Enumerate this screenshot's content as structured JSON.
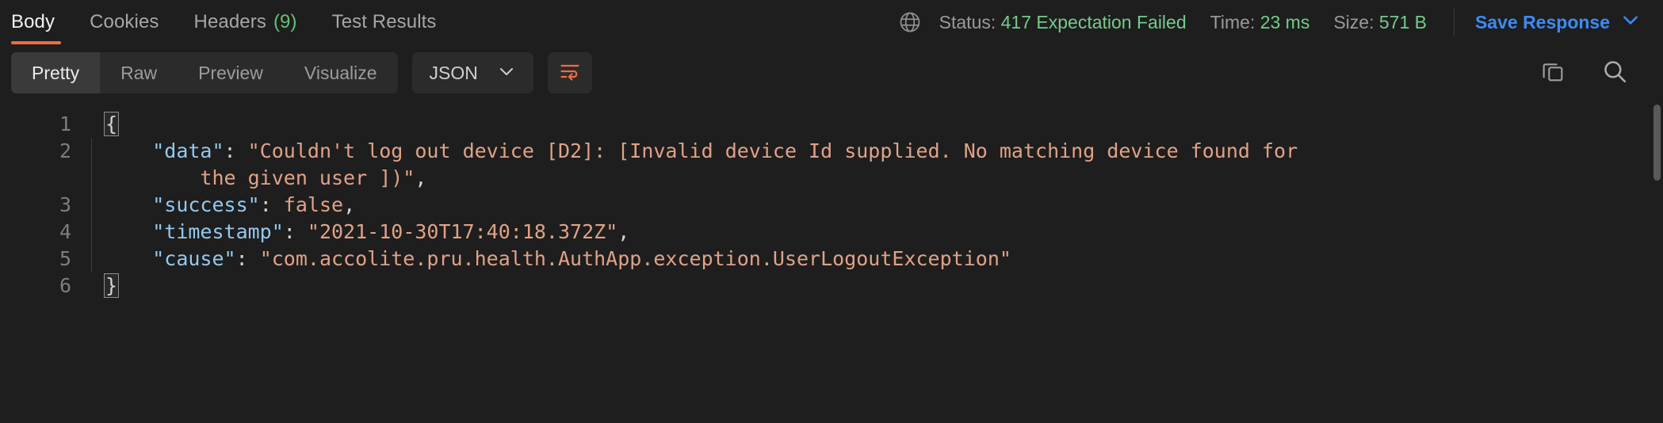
{
  "response_tabs": [
    {
      "label": "Body",
      "active": true,
      "count": null
    },
    {
      "label": "Cookies",
      "active": false,
      "count": null
    },
    {
      "label": "Headers",
      "active": false,
      "count": "(9)"
    },
    {
      "label": "Test Results",
      "active": false,
      "count": null
    }
  ],
  "status": {
    "globe_icon": "globe-icon",
    "status_label": "Status: ",
    "status_value": "417 Expectation Failed",
    "time_label": "Time: ",
    "time_value": "23 ms",
    "size_label": "Size: ",
    "size_value": "571 B",
    "save_response_label": "Save Response",
    "save_chevron_icon": "chevron-down-icon"
  },
  "toolbar": {
    "view_tabs": [
      {
        "label": "Pretty",
        "active": true
      },
      {
        "label": "Raw",
        "active": false
      },
      {
        "label": "Preview",
        "active": false
      },
      {
        "label": "Visualize",
        "active": false
      }
    ],
    "language": "JSON",
    "language_chevron_icon": "chevron-down-icon",
    "wrap_icon": "wrap-lines-icon",
    "copy_icon": "copy-icon",
    "search_icon": "search-icon"
  },
  "code": {
    "lines": [
      {
        "number": "1",
        "segments": [
          {
            "t": "{",
            "c": "brace"
          }
        ]
      },
      {
        "number": "2",
        "segments": [
          {
            "t": "    ",
            "c": "p"
          },
          {
            "t": "\"data\"",
            "c": "k"
          },
          {
            "t": ": ",
            "c": "p"
          },
          {
            "t": "\"Couldn't log out device [D2]: [Invalid device Id supplied. No matching device found for",
            "c": "s"
          }
        ]
      },
      {
        "number": "",
        "segments": [
          {
            "t": "        ",
            "c": "p"
          },
          {
            "t": "the given user ])\"",
            "c": "s"
          },
          {
            "t": ",",
            "c": "p"
          }
        ]
      },
      {
        "number": "3",
        "segments": [
          {
            "t": "    ",
            "c": "p"
          },
          {
            "t": "\"success\"",
            "c": "k"
          },
          {
            "t": ": ",
            "c": "p"
          },
          {
            "t": "false",
            "c": "b"
          },
          {
            "t": ",",
            "c": "p"
          }
        ]
      },
      {
        "number": "4",
        "segments": [
          {
            "t": "    ",
            "c": "p"
          },
          {
            "t": "\"timestamp\"",
            "c": "k"
          },
          {
            "t": ": ",
            "c": "p"
          },
          {
            "t": "\"2021-10-30T17:40:18.372Z\"",
            "c": "s"
          },
          {
            "t": ",",
            "c": "p"
          }
        ]
      },
      {
        "number": "5",
        "segments": [
          {
            "t": "    ",
            "c": "p"
          },
          {
            "t": "\"cause\"",
            "c": "k"
          },
          {
            "t": ": ",
            "c": "p"
          },
          {
            "t": "\"com.accolite.pru.health.AuthApp.exception.UserLogoutException\"",
            "c": "s"
          }
        ]
      },
      {
        "number": "6",
        "segments": [
          {
            "t": "}",
            "c": "brace"
          }
        ]
      }
    ]
  },
  "colors": {
    "accent_orange": "#ef6c40",
    "success_green": "#75cb8b",
    "link_blue": "#3b8bf5",
    "json_key": "#93c9ee",
    "json_string": "#e0a287",
    "background": "#1e1e1e"
  }
}
